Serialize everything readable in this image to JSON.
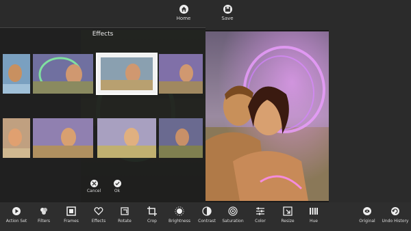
{
  "top_toolbar": {
    "home": {
      "label": "Home",
      "icon": "home-icon"
    },
    "save": {
      "label": "Save",
      "icon": "save-icon"
    }
  },
  "effects_panel": {
    "title": "Effects",
    "cancel": {
      "label": "Cancel",
      "icon": "close-icon"
    },
    "ok": {
      "label": "Ok",
      "icon": "check-icon"
    }
  },
  "bottom_toolbar": [
    {
      "label": "Action Set",
      "icon": "play-icon"
    },
    {
      "label": "Filters",
      "icon": "filters-icon"
    },
    {
      "label": "Frames",
      "icon": "frames-icon"
    },
    {
      "label": "Effects",
      "icon": "heart-icon"
    },
    {
      "label": "Rotate",
      "icon": "rotate-icon"
    },
    {
      "label": "Crop",
      "icon": "crop-icon"
    },
    {
      "label": "Brightness",
      "icon": "brightness-icon"
    },
    {
      "label": "Contrast",
      "icon": "contrast-icon"
    },
    {
      "label": "Saturation",
      "icon": "saturation-icon"
    },
    {
      "label": "Color",
      "icon": "color-icon"
    },
    {
      "label": "Resize",
      "icon": "resize-icon"
    },
    {
      "label": "Hue",
      "icon": "hue-icon"
    },
    {
      "label": "Original",
      "icon": "original-icon"
    },
    {
      "label": "Undo History",
      "icon": "undo-history-icon"
    }
  ]
}
